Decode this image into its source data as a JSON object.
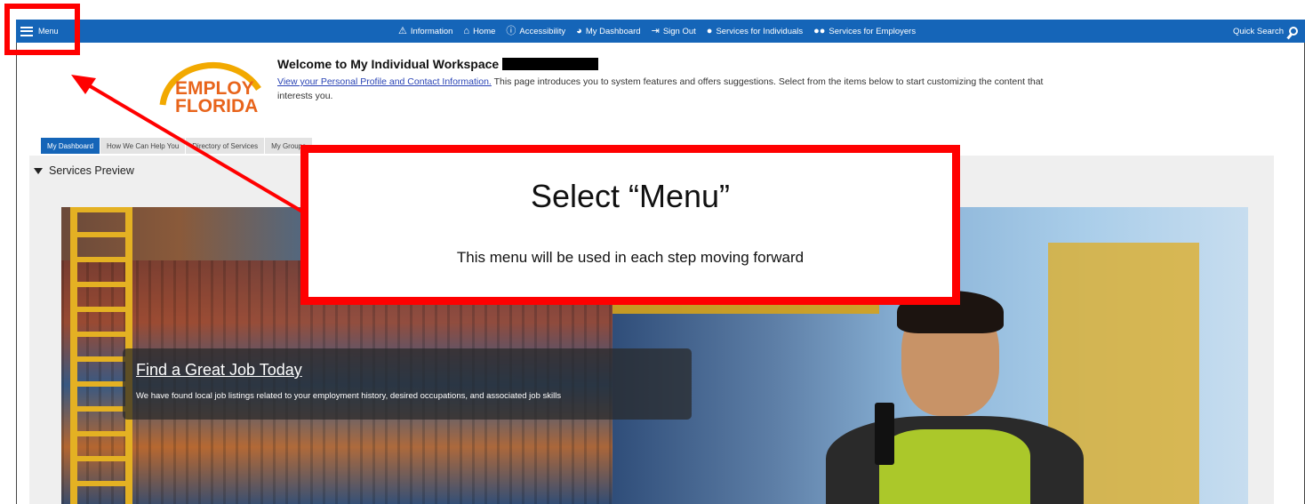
{
  "nav": {
    "menu_label": "Menu",
    "items": [
      {
        "label": "Information",
        "icon": "warning-icon"
      },
      {
        "label": "Home",
        "icon": "home-icon"
      },
      {
        "label": "Accessibility",
        "icon": "info-circle-icon"
      },
      {
        "label": "My Dashboard",
        "icon": "dashboard-icon"
      },
      {
        "label": "Sign Out",
        "icon": "sign-out-icon"
      },
      {
        "label": "Services for Individuals",
        "icon": "user-icon"
      },
      {
        "label": "Services for Employers",
        "icon": "group-icon"
      }
    ],
    "quick_search_label": "Quick Search"
  },
  "header": {
    "logo_line1": "EMPLOY",
    "logo_line2": "FLORIDA",
    "welcome_title": "Welcome to My Individual Workspace",
    "profile_link": "View your Personal Profile and Contact Information.",
    "intro_text": " This page introduces you to system features and offers suggestions. Select from the items below to start customizing the content that interests you."
  },
  "tabs": [
    {
      "label": "My Dashboard",
      "active": true
    },
    {
      "label": "How We Can Help You",
      "active": false
    },
    {
      "label": "Directory of Services",
      "active": false
    },
    {
      "label": "My Groups",
      "active": false
    }
  ],
  "section": {
    "title": "Services Preview"
  },
  "hero": {
    "job_title": "Find a Great Job Today",
    "job_desc": "We have found local job listings related to your employment history, desired occupations, and associated job skills"
  },
  "annotation": {
    "title": "Select “Menu”",
    "subtitle": "This menu will be used in each step moving forward",
    "color": "#ff0000"
  },
  "colors": {
    "nav_bg": "#1565b8",
    "accent_yellow": "#f2a900"
  }
}
